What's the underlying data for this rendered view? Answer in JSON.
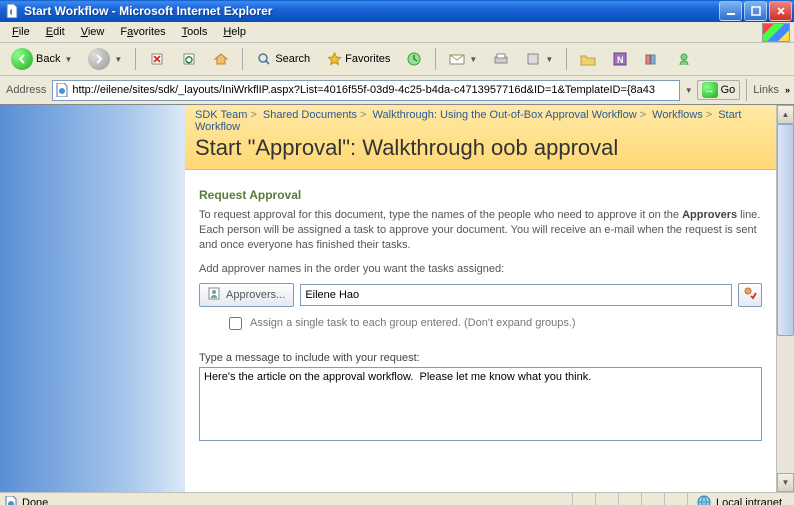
{
  "window": {
    "title": "Start Workflow - Microsoft Internet Explorer"
  },
  "menu": {
    "file": "File",
    "edit": "Edit",
    "view": "View",
    "favorites": "Favorites",
    "tools": "Tools",
    "help": "Help"
  },
  "toolbar": {
    "back": "Back",
    "search": "Search",
    "favorites": "Favorites"
  },
  "addressbar": {
    "label": "Address",
    "url": "http://eilene/sites/sdk/_layouts/IniWrkflIP.aspx?List=4016f55f-03d9-4c25-b4da-c4713957716d&ID=1&TemplateID={8a43",
    "go": "Go",
    "links": "Links"
  },
  "breadcrumb": {
    "items": [
      "SDK Team",
      "Shared Documents",
      "Walkthrough: Using the Out-of-Box Approval Workflow",
      "Workflows",
      "Start Workflow"
    ]
  },
  "page": {
    "heading": "Start \"Approval\": Walkthrough oob approval",
    "section_title": "Request Approval",
    "desc_before": "To request approval for this document, type the names of the people who need to approve it on the ",
    "desc_bold": "Approvers",
    "desc_after": " line. Each person will be assigned a task to approve your document. You will receive an e-mail when the request is sent and once everyone has finished their tasks.",
    "hint": "Add approver names in the order you want the tasks assigned:",
    "approvers_button": "Approvers...",
    "approvers_value": "Eilene Hao",
    "checkbox_label": "Assign a single task to each group entered. (Don't expand groups.)",
    "message_label": "Type a message to include with your request:",
    "message_value": "Here's the article on the approval workflow.  Please let me know what you think."
  },
  "status": {
    "text": "Done",
    "zone": "Local intranet"
  }
}
